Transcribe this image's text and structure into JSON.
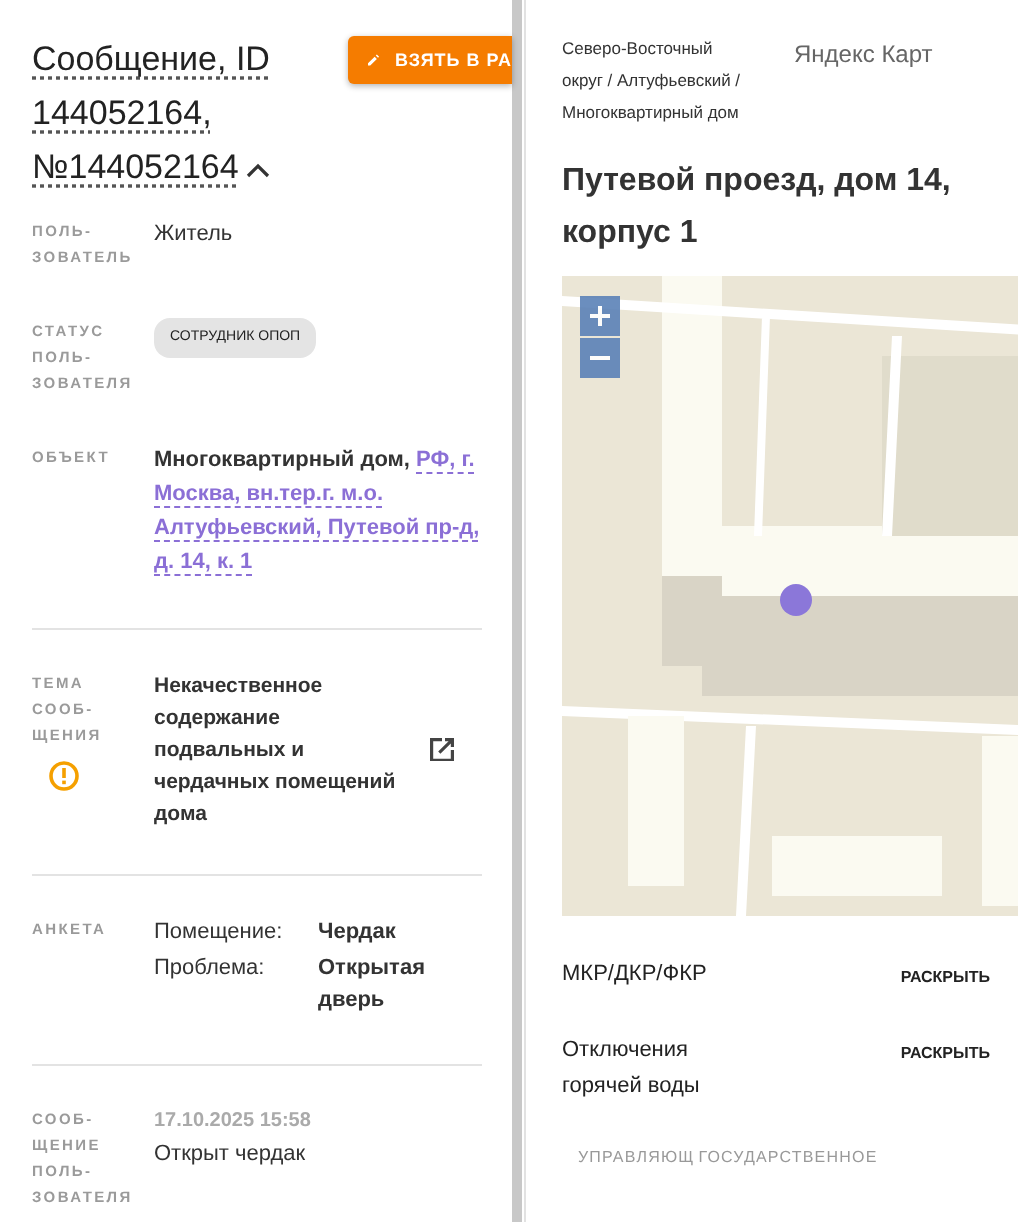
{
  "message": {
    "title": "Сообщение, ID 144052164, №144052164",
    "expanded": true,
    "take_button": "ВЗЯТЬ В РА",
    "fields": [
      {
        "kind": "text",
        "label": "ПОЛЬ-ЗОВАТЕЛЬ",
        "value": "Житель"
      },
      {
        "kind": "tag",
        "label": "СТАТУС ПОЛЬ-ЗОВАТЕЛЯ",
        "value": "СОТРУДНИК ОПОП"
      },
      {
        "kind": "object",
        "label": "ОБЪЕКТ",
        "type": "Многоквартирный дом,",
        "address": "РФ, г. Москва, вн.тер.г. м.о. Алтуфьевский, Путевой пр-д, д. 14, к. 1"
      },
      {
        "kind": "topic",
        "label": "ТЕМА СООБ-ЩЕНИЯ",
        "value": "Некачественное содержание подвальных и чердачных помещений дома",
        "warning": true
      },
      {
        "kind": "survey",
        "label": "АНКЕТА",
        "pairs": [
          {
            "key": "Помещение:",
            "value": "Чердак"
          },
          {
            "key": "Проблема:",
            "value": "Открытая дверь"
          }
        ]
      },
      {
        "kind": "message",
        "label": "СООБ-ЩЕНИЕ ПОЛЬ-ЗОВАТЕЛЯ",
        "time": "17.10.2025 15:58",
        "value": "Открыт чердак"
      }
    ]
  },
  "object_panel": {
    "breadcrumb": "Северо-Восточный округ / Алтуфьевский / Многоквартирный дом",
    "map_link": "Яндекс Карт",
    "address": "Путевой проезд, дом 14, корпус 1",
    "sections": [
      {
        "title": "МКР/ДКР/ФКР",
        "action": "РАСКРЫТЬ"
      },
      {
        "title": "Отключения горячей воды",
        "action": "РАСКРЫТЬ"
      }
    ],
    "footer": [
      "УПРАВЛЯЮЩ",
      "ГОСУДАРСТВЕННОЕ"
    ]
  }
}
